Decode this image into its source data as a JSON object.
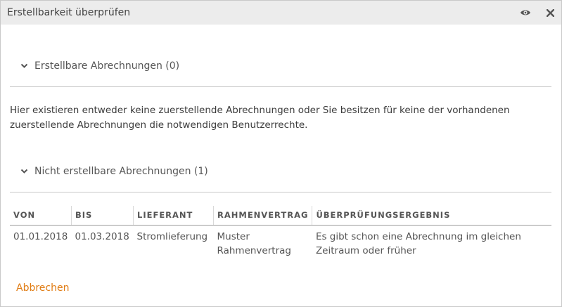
{
  "dialog": {
    "title": "Erstellbarkeit überprüfen",
    "icons": [
      "eye-icon",
      "close-icon"
    ]
  },
  "section_creatable": {
    "label": "Erstellbare Abrechnungen (0)",
    "message": "Hier existieren entweder keine zuerstellende Abrechnungen oder Sie besitzen für keine der vorhandenen zuerstellende Abrechnungen die notwendigen Benutzerrechte."
  },
  "section_not_creatable": {
    "label": "Nicht erstellbare Abrechnungen (1)",
    "table": {
      "headers": [
        "VON",
        "BIS",
        "LIEFERANT",
        "RAHMENVERTRAG",
        "ÜBERPRÜFUNGSERGEBNIS"
      ],
      "rows": [
        [
          "01.01.2018",
          "01.03.2018",
          "Stromlieferung",
          "Muster Rahmenvertrag",
          "Es gibt schon eine Abrechnung im gleichen Zeitraum oder früher"
        ]
      ]
    }
  },
  "footer": {
    "cancel_label": "Abbrechen"
  },
  "colors": {
    "titlebar_bg": "#ececec",
    "accent_link": "#e07b12"
  }
}
